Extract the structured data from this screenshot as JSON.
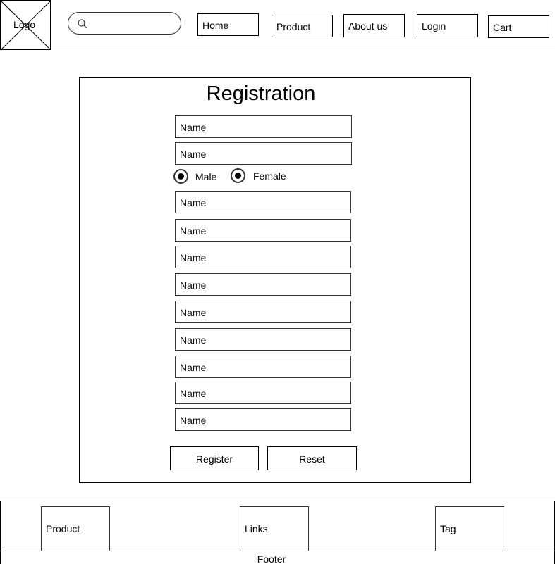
{
  "header": {
    "logo_label": "Logo",
    "search": {
      "placeholder": "",
      "icon": "search-icon"
    },
    "nav": {
      "home": "Home",
      "product": "Product",
      "about": "About us",
      "login": "Login",
      "cart": "Cart"
    }
  },
  "registration": {
    "title": "Registration",
    "fields": [
      "Name",
      "Name",
      "Name",
      "Name",
      "Name",
      "Name",
      "Name",
      "Name",
      "Name",
      "Name",
      "Name"
    ],
    "gender": {
      "male": "Male",
      "female": "Female"
    },
    "register_label": "Register",
    "reset_label": "Reset"
  },
  "footer": {
    "product": "Product",
    "links": "Links",
    "tag": "Tag",
    "label": "Footer"
  }
}
